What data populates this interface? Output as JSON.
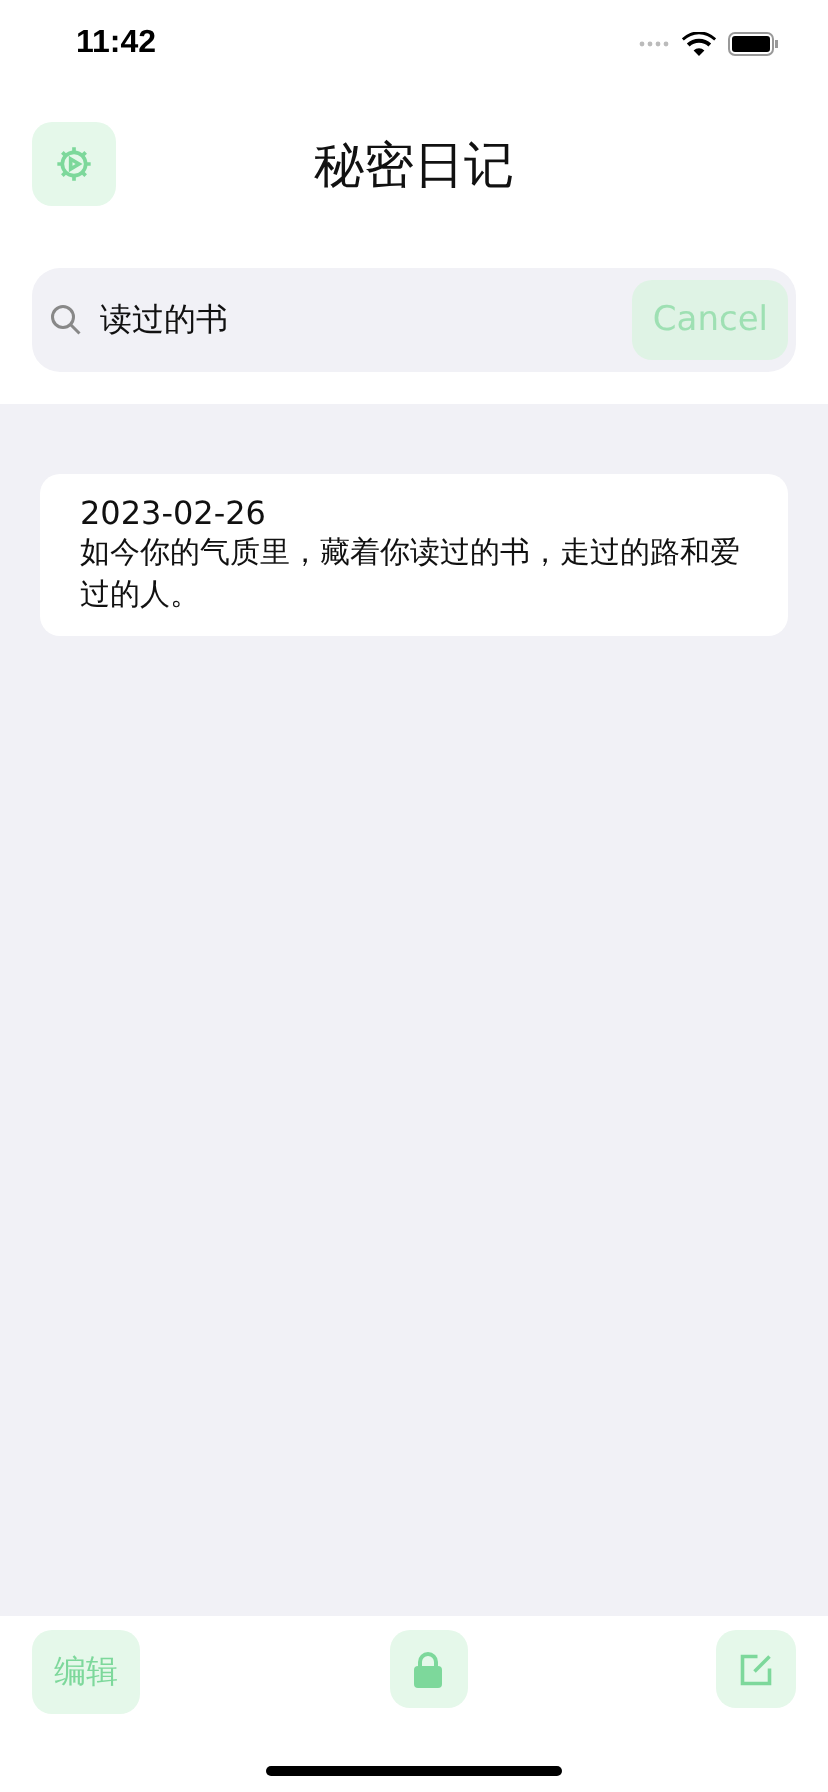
{
  "status_bar": {
    "time": "11:42"
  },
  "header": {
    "title": "秘密日记"
  },
  "search": {
    "value": "读过的书",
    "cancel": "Cancel"
  },
  "entries": [
    {
      "date": "2023-02-26",
      "text": "如今你的气质里，藏着你读过的书，走过的路和爱过的人。"
    }
  ],
  "toolbar": {
    "edit": "编辑"
  }
}
